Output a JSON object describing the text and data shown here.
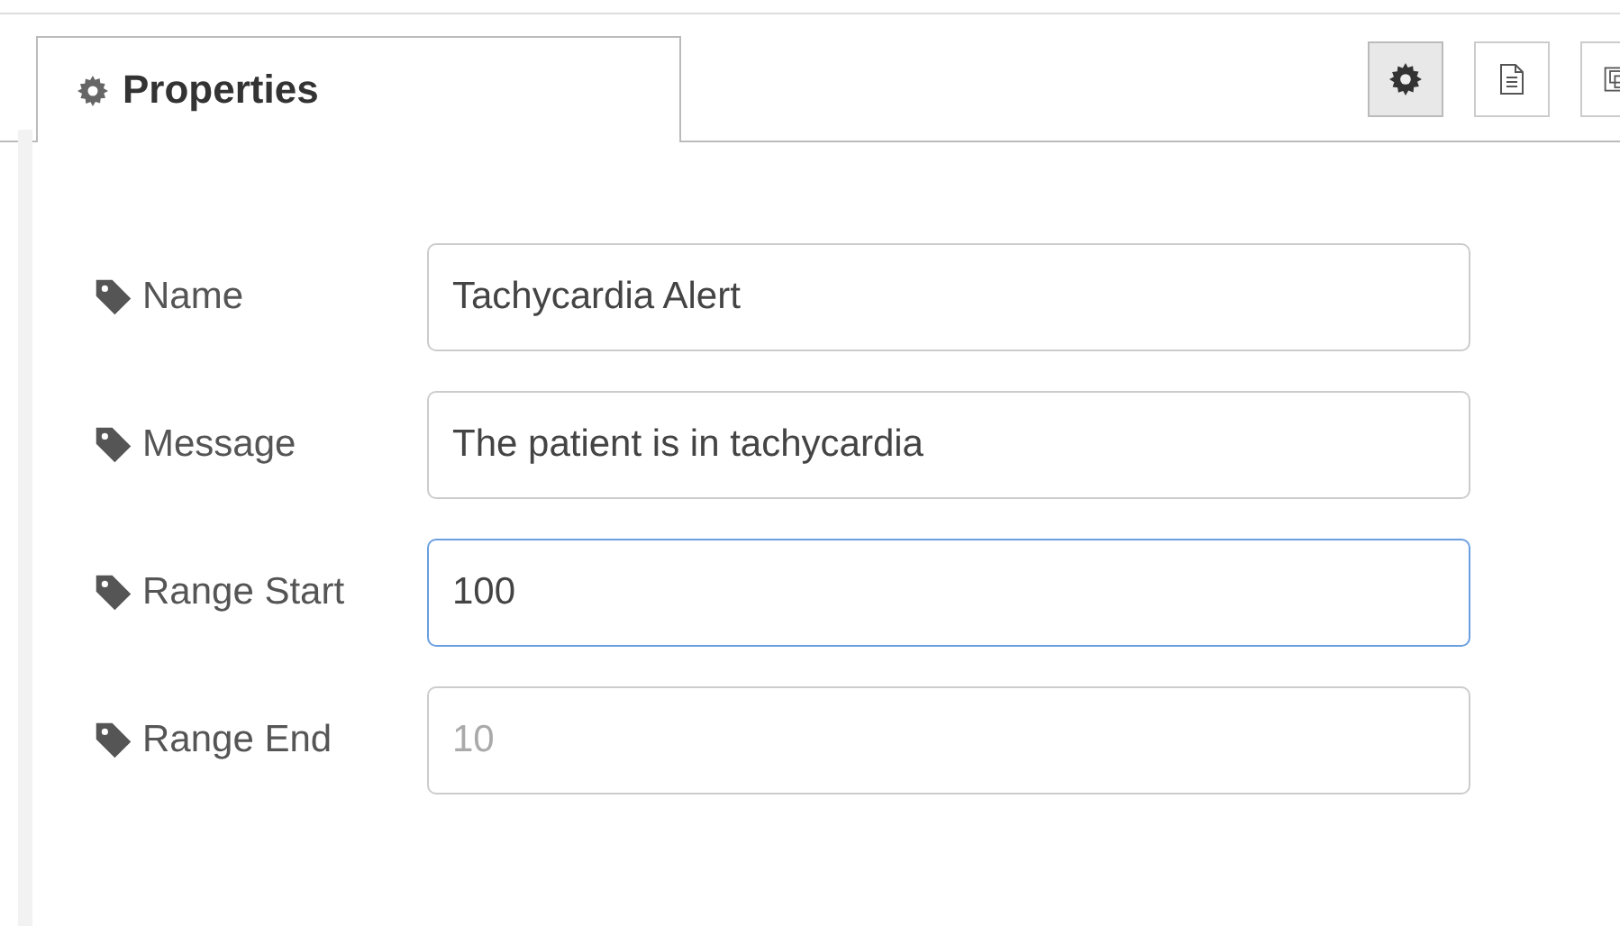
{
  "tab": {
    "label": "Properties",
    "selected": true
  },
  "toolbar": [
    {
      "kind": "settings",
      "selected": true
    },
    {
      "kind": "document",
      "selected": false
    },
    {
      "kind": "frame",
      "selected": false
    }
  ],
  "fields": [
    {
      "label": "Name",
      "value": "Tachycardia Alert",
      "focused": false
    },
    {
      "label": "Message",
      "value": "The patient is in tachycardia",
      "focused": false
    },
    {
      "label": "Range Start",
      "value": "100",
      "focused": true
    },
    {
      "label": "Range End",
      "placeholder": "10",
      "focused": false
    }
  ]
}
